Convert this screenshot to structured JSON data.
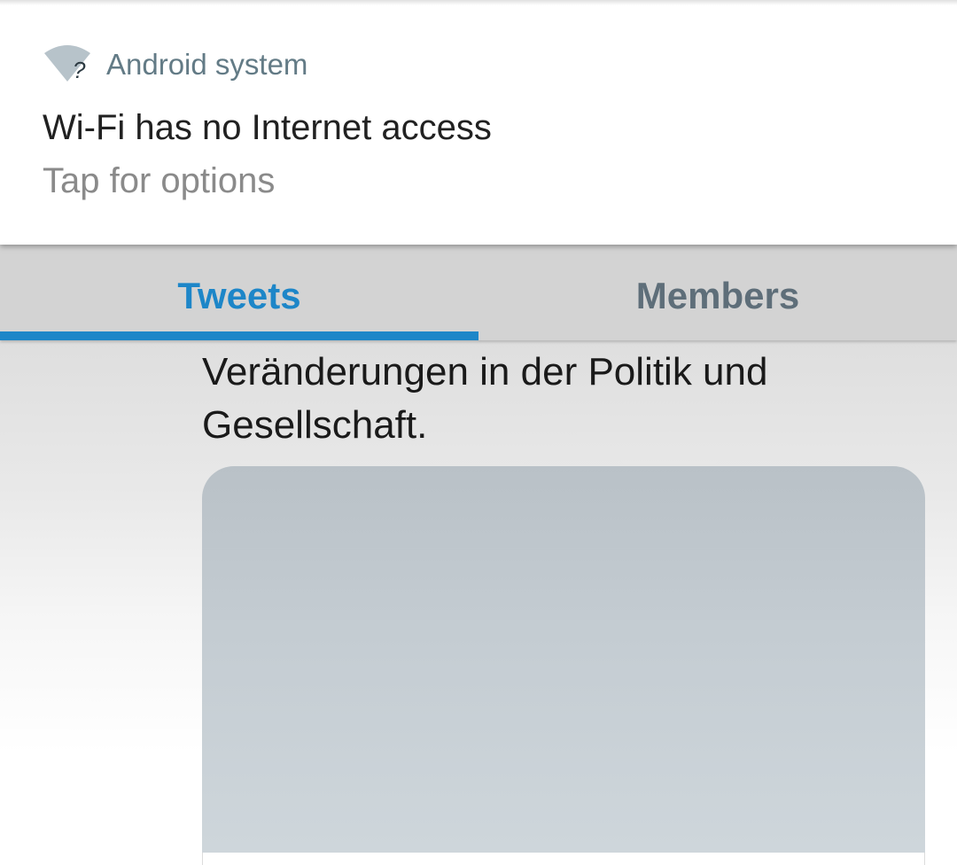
{
  "notification": {
    "app_name": "Android system",
    "icon": "wifi-question-icon",
    "title": "Wi-Fi has no Internet access",
    "text": "Tap for options"
  },
  "tabs": [
    {
      "label": "Tweets",
      "active": true
    },
    {
      "label": "Members",
      "active": false
    }
  ],
  "tweet": {
    "text_lines": [
      "Veränderungen in der Politik und",
      "Gesellschaft."
    ]
  },
  "colors": {
    "accent": "#1d86c8",
    "inactive_tab": "#5e6e79",
    "app_name": "#637b86"
  }
}
